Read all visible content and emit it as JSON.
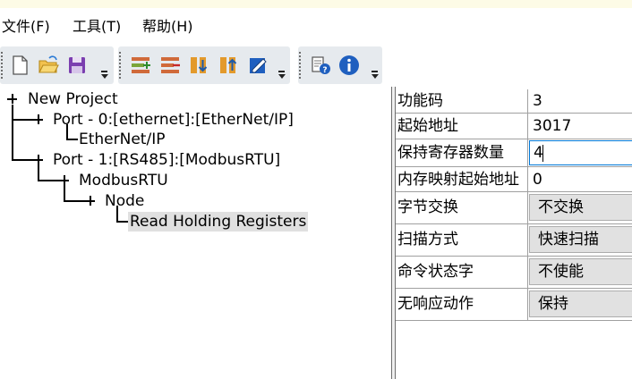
{
  "menu": {
    "file": "文件(F)",
    "tools": "工具(T)",
    "help": "帮助(H)"
  },
  "toolbar": {
    "groups": [
      [
        "new-file-icon",
        "open-folder-icon",
        "save-icon"
      ],
      [
        "add-port-icon",
        "delete-icon",
        "download-icon",
        "upload-icon",
        "edit-icon"
      ],
      [
        "help-icon",
        "info-icon"
      ]
    ]
  },
  "tree": {
    "root": "New Project",
    "port0": "Port - 0:[ethernet]:[EtherNet/IP]",
    "port0_child": "EtherNet/IP",
    "port1": "Port - 1:[RS485]:[ModbusRTU]",
    "modbus": "ModbusRTU",
    "node": "Node",
    "read_holding": "Read Holding Registers"
  },
  "properties": [
    {
      "name": "功能码",
      "value": "3",
      "kind": "text"
    },
    {
      "name": "起始地址",
      "value": "3017",
      "kind": "text"
    },
    {
      "name": "保持寄存器数量",
      "value": "4",
      "kind": "edit"
    },
    {
      "name": "内存映射起始地址",
      "value": "0",
      "kind": "text"
    },
    {
      "name": "字节交换",
      "value": "不交换",
      "kind": "combo"
    },
    {
      "name": "扫描方式",
      "value": "快速扫描",
      "kind": "combo"
    },
    {
      "name": "命令状态字",
      "value": "不使能",
      "kind": "combo"
    },
    {
      "name": "无响应动作",
      "value": "保持",
      "kind": "combo"
    }
  ],
  "colors": {
    "accent": "#0078d7",
    "toolbar_bg": "#e6eaee",
    "combo_bg": "#e1e1e1",
    "selection_bg": "#e0e0e0"
  }
}
